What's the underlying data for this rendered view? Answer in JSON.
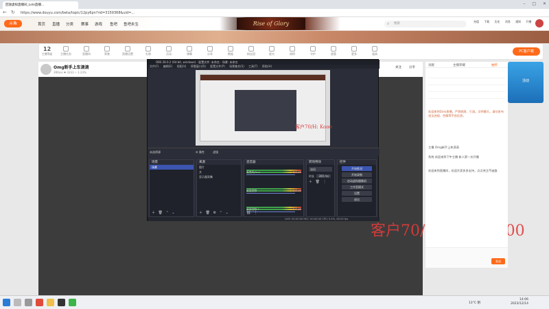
{
  "browser": {
    "tab_title": "回放虚拟直播间_Lolo直播...",
    "url": "https://www.douyu.com/beta/topic/12py6pn?rid=3159368&uid=..."
  },
  "site": {
    "logo": "斗鱼",
    "nav": [
      "首页",
      "直播",
      "分类",
      "赛事",
      "游戏",
      "鱼吧",
      "鱼吧永生"
    ],
    "banner_text": "Rise of Glory",
    "search_placeholder": "搜索",
    "user_links": [
      "充值",
      "下载",
      "历史",
      "消息",
      "通知",
      "开播"
    ]
  },
  "toolbar": {
    "level": "12",
    "level_label": "主播等级",
    "items": [
      "主播任务",
      "直播间",
      "荣誉",
      "直播设置",
      "礼物",
      "活动",
      "弹幕",
      "分享",
      "数据",
      "粉丝团",
      "星光",
      "周榜",
      "守护",
      "超管",
      "更多",
      "道具"
    ],
    "pc_button": "PC客户端"
  },
  "stream": {
    "title": "Omg新手上车滴滴",
    "meta": "39fans  ❤ 3333  ⚡ 3.33%",
    "follow_label": "关注",
    "share_label": "分享"
  },
  "obs": {
    "title": "OBS 28.0.2 (64-bit, windows) - 配置文件: 未命名 - 场景: 未命名",
    "menu": [
      "文件(F)",
      "编辑(E)",
      "视图(V)",
      "停靠窗口(D)",
      "配置文件(P)",
      "场景集合(S)",
      "工具(T)",
      "帮助(H)"
    ],
    "no_source": "未选择源",
    "prop_btn": "⚙ 属性",
    "filter_btn": "滤镜",
    "docks": {
      "scenes": {
        "title": "场景",
        "items": [
          "场景"
        ]
      },
      "sources": {
        "title": "来源",
        "items": [
          "图片",
          "文",
          "显示器采集"
        ]
      },
      "mixer": {
        "title": "混音器",
        "channels": [
          {
            "name": "麦克风/Aux",
            "db": "0.0 dB"
          },
          {
            "name": "桌面音频",
            "db": "0.0 dB"
          },
          {
            "name": "桌面音频 2",
            "db": "0.0 dB"
          }
        ]
      },
      "transitions": {
        "title": "转场特效",
        "type": "淡出",
        "duration_label": "时长",
        "duration": "300 ms"
      },
      "controls": {
        "title": "控件",
        "buttons": [
          "开始推流",
          "开始录制",
          "启动虚拟摄像机",
          "工作室模式",
          "设置",
          "退出"
        ]
      }
    },
    "status": "LIVE: 00:00:00   REC: 00:00:00   CPU: 0.4%, 60.00 fps"
  },
  "watermark": "客户70/H: Kooo3000",
  "watermark_small": "客户70/H: Kooo",
  "chat": {
    "tabs": [
      "贡献",
      "主播荣耀",
      "抽奖"
    ],
    "lines": [
      "欢迎来到Dolo直播，严禁刷屏、引流。文明聊天，请勿发布违法违规、色情等不良信息。",
      "主播 Omg新手上车滴滴",
      "系统 欢迎来到下午主播 新人第一次开播",
      "欢迎来到直播间，欢迎大家多多支持，点点关注不迷路"
    ],
    "send_label": "发送"
  },
  "side_ad": "活动",
  "taskbar": {
    "weather": "13°C 阴",
    "time": "14:06",
    "date": "2023/12/14"
  }
}
